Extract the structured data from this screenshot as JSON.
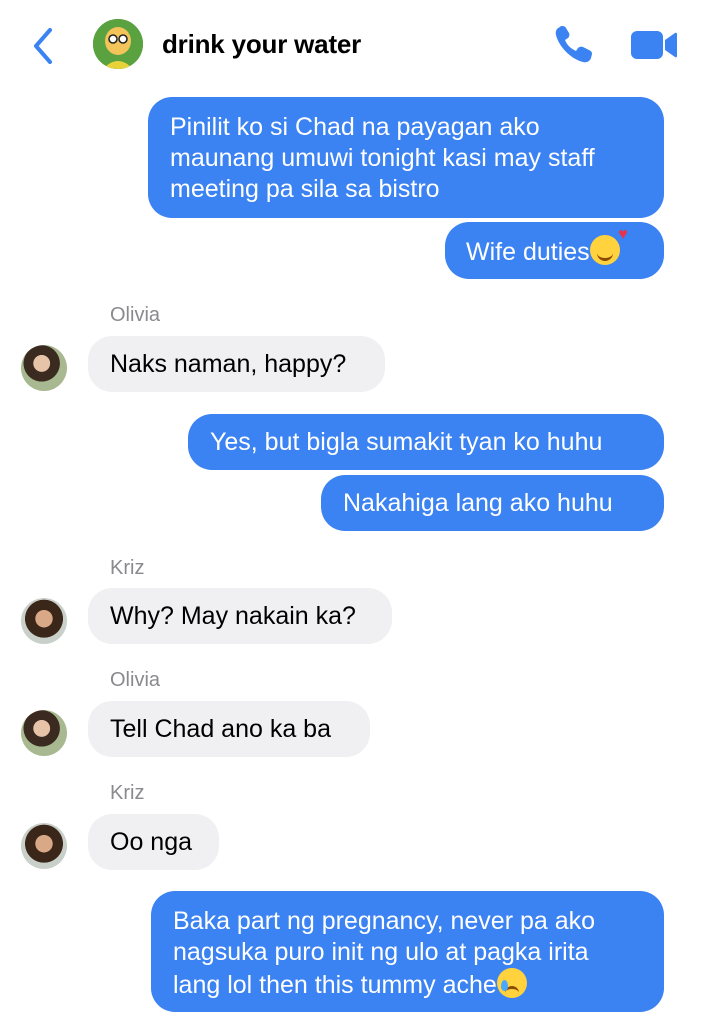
{
  "header": {
    "title": "drink your water",
    "back_icon": "chevron-left-icon",
    "call_icon": "phone-icon",
    "video_icon": "video-camera-icon",
    "accent": "#3b82f2"
  },
  "messages": [
    {
      "type": "out",
      "lines": [
        "Pinilit ko si Chad na payagan ako",
        "maunang umuwi tonight kasi may staff",
        "meeting pa sila sa bistro"
      ]
    },
    {
      "type": "out",
      "text": "Wife duties",
      "emoji": "smiling-face-with-hearts"
    },
    {
      "type": "in",
      "sender": "Olivia",
      "text": "Naks naman, happy?"
    },
    {
      "type": "out",
      "text": "Yes, but bigla sumakit tyan ko huhu"
    },
    {
      "type": "out",
      "text": "Nakahiga lang ako huhu"
    },
    {
      "type": "in",
      "sender": "Kriz",
      "text": "Why? May nakain ka?"
    },
    {
      "type": "in",
      "sender": "Olivia",
      "text": "Tell Chad ano ka ba"
    },
    {
      "type": "in",
      "sender": "Kriz",
      "text": "Oo nga"
    },
    {
      "type": "out",
      "lines": [
        "Baka part ng pregnancy, never pa ako",
        "nagsuka puro init ng ulo at pagka irita",
        "lang lol then this tummy ache"
      ],
      "emoji": "crying-face"
    }
  ],
  "colors": {
    "outgoing_bubble": "#3b82f2",
    "incoming_bubble": "#f0f0f2",
    "sender_label": "#8a8a8e"
  }
}
